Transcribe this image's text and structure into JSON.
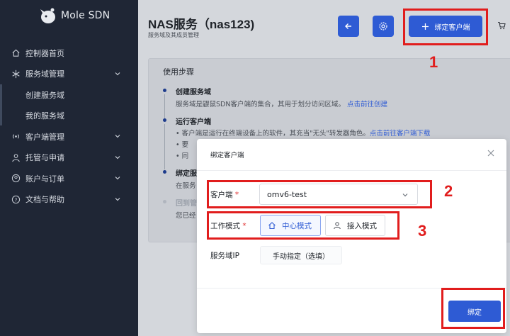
{
  "app": {
    "name": "Mole SDN"
  },
  "sidebar": {
    "items": [
      {
        "label": "控制器首页",
        "icon": "home-icon"
      },
      {
        "label": "服务域管理",
        "icon": "snowflake-icon"
      },
      {
        "label": "创建服务域"
      },
      {
        "label": "我的服务域"
      },
      {
        "label": "客户端管理",
        "icon": "broadcast-icon"
      },
      {
        "label": "托管与申请",
        "icon": "user-tie-icon"
      },
      {
        "label": "账户与订单",
        "icon": "account-icon"
      },
      {
        "label": "文档与帮助",
        "icon": "question-icon"
      }
    ]
  },
  "header": {
    "title": "NAS服务（nas123)",
    "subtitle": "服务域及其成员管理",
    "bind_label": "绑定客户端"
  },
  "usage": {
    "title": "使用步骤",
    "steps": [
      {
        "title": "创建服务域",
        "desc": "服务域是鼹鼠SDN客户端的集合，其用于划分访问区域。",
        "link": "点击前往创建"
      },
      {
        "title": "运行客户端",
        "desc": "客户端是运行在终端设备上的软件，其充当\"无头\"转发器角色。",
        "link": "点击前往客户端下载",
        "bullets": [
          "要",
          "同"
        ]
      },
      {
        "title": "绑定服",
        "desc": "在服务"
      },
      {
        "title": "回到管",
        "desc": "您已经"
      }
    ]
  },
  "modal": {
    "title": "绑定客户端",
    "client_label": "客户端",
    "client_value": "omv6-test",
    "mode_label": "工作模式",
    "mode_center": "中心模式",
    "mode_access": "接入模式",
    "ip_label": "服务域IP",
    "ip_button": "手动指定（选填）",
    "submit": "绑定"
  },
  "annotations": {
    "n1": "1",
    "n2": "2",
    "n3": "3"
  },
  "colors": {
    "primary": "#2e5bd4",
    "sidebar": "#1f2635",
    "annotation": "#e11d1d"
  }
}
